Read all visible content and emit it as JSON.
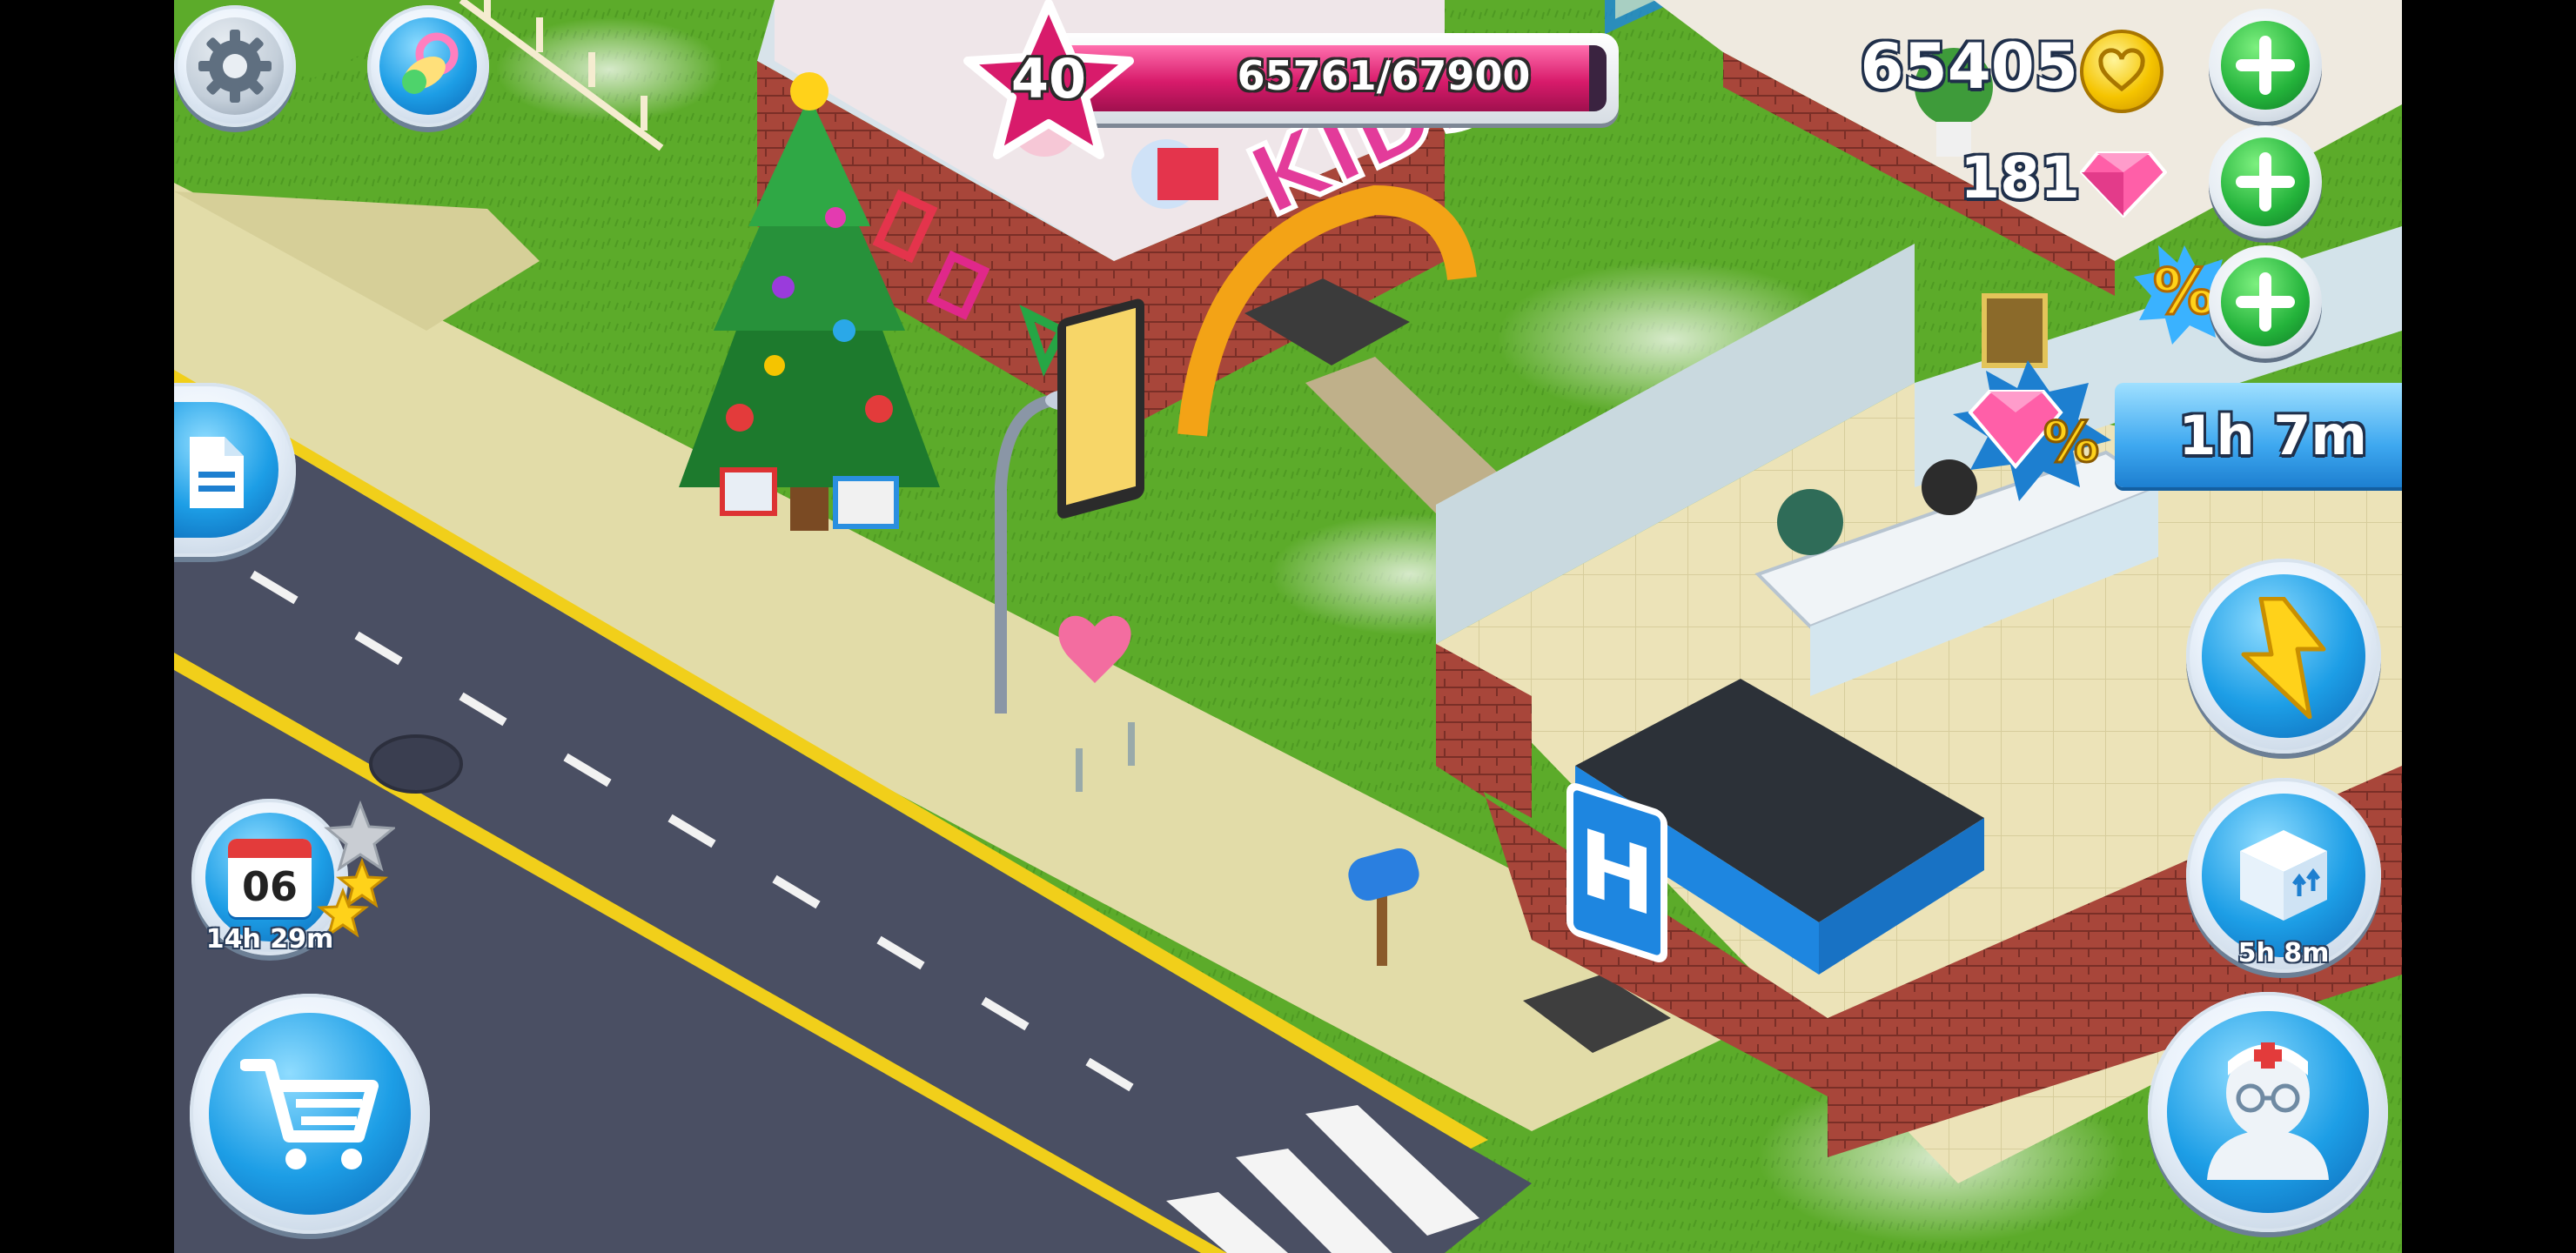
{
  "player": {
    "level": "40",
    "xp_text": "65761/67900",
    "xp_fraction": 0.9685
  },
  "currency": {
    "coins": "65405",
    "gems": "181"
  },
  "sale": {
    "timer": "1h 7m",
    "percent_symbol": "%"
  },
  "daily": {
    "day": "06",
    "timer": "14h 29m"
  },
  "delivery": {
    "timer": "5h 8m"
  },
  "scene": {
    "sign_letter": "H",
    "kids_sign": "KIDS"
  },
  "icons": {
    "settings": "gear-icon",
    "pacifier": "pacifier-icon",
    "document": "document-icon",
    "calendar": "calendar-icon",
    "shop": "shopping-cart-icon",
    "boost": "lightning-bolt-icon",
    "delivery": "box-delivery-icon",
    "staff": "doctor-icon",
    "coin": "coin-icon",
    "gem": "gem-icon",
    "percent": "percent-badge-icon",
    "plus": "plus-icon"
  },
  "colors": {
    "xp_bar": "#d81b6b",
    "plus_green": "#24b33b",
    "button_blue": "#1d9ee6",
    "gold": "#f5c400",
    "gem_pink": "#ff5fa8"
  }
}
